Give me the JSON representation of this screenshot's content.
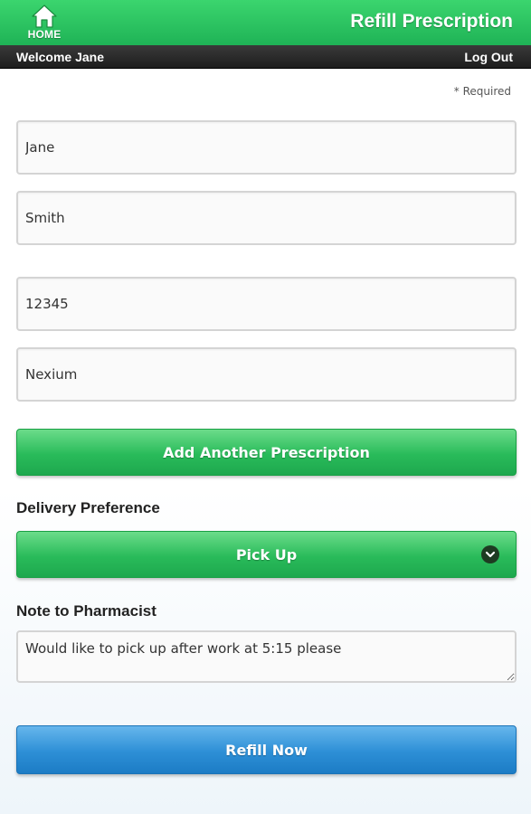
{
  "header": {
    "home_label": "HOME",
    "home_icon": "home-icon",
    "title": "Refill Prescription",
    "accent_color": "#29bb5a"
  },
  "subbar": {
    "welcome": "Welcome Jane",
    "logout": "Log Out"
  },
  "form": {
    "required_note": "* Required",
    "first_name": "Jane",
    "last_name": "Smith",
    "rx_number": "12345",
    "medication": "Nexium",
    "add_button": "Add Another Prescription",
    "delivery_label": "Delivery Preference",
    "delivery_value": "Pick Up",
    "delivery_icon": "chevron-down-icon",
    "note_label": "Note to Pharmacist",
    "note_value": "Would like to pick up after work at 5:15 please",
    "submit_button": "Refill Now",
    "submit_color": "#2d8fd6"
  }
}
